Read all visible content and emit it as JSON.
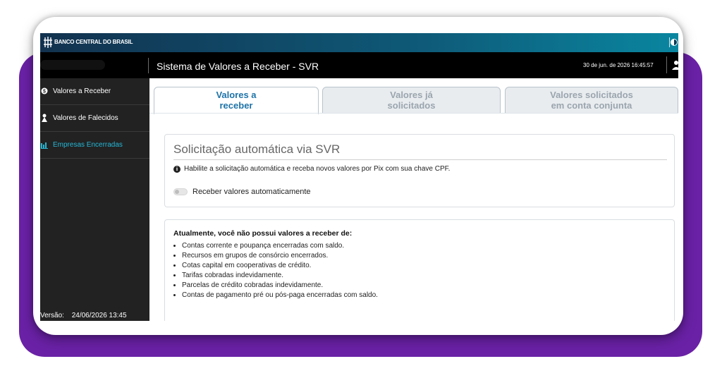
{
  "header": {
    "org_name": "BANCO CENTRAL DO BRASIL",
    "app_title": "Sistema de Valores a Receber - SVR",
    "datetime": "30 de jun. de 2026 16:45:57"
  },
  "sidebar": {
    "items": [
      {
        "label": "Valores a Receber",
        "icon": "money-icon"
      },
      {
        "label": "Valores de Falecidos",
        "icon": "person-icon"
      },
      {
        "label": "Empresas Encerradas",
        "icon": "bar-chart-icon",
        "active": true
      }
    ],
    "version_label": "Versão:",
    "version_value": "24/06/2026 13:45"
  },
  "tabs": [
    {
      "line1": "Valores a",
      "line2": "receber",
      "active": true
    },
    {
      "line1": "Valores já",
      "line2": "solicitados"
    },
    {
      "line1": "Valores solicitados",
      "line2": "em conta conjunta"
    }
  ],
  "auto_card": {
    "title": "Solicitação automática via SVR",
    "info": "Habilite a solicitação automática e receba novos valores por Pix com sua chave CPF.",
    "toggle_label": "Receber valores automaticamente",
    "toggle_on": false
  },
  "values_card": {
    "title": "Atualmente, você não possui valores a receber de:",
    "items": [
      "Contas corrente e poupança encerradas com saldo.",
      "Recursos em grupos de consórcio encerrados.",
      "Cotas capital em cooperativas de crédito.",
      "Tarifas cobradas indevidamente.",
      "Parcelas de crédito cobradas indevidamente.",
      "Contas de pagamento pré ou pós-paga encerradas com saldo."
    ]
  },
  "colors": {
    "background_accent": "#6a21a6",
    "active_tab": "#1e73a8",
    "active_sidebar": "#25b7d6",
    "gov_bar": "#0e5a78"
  }
}
